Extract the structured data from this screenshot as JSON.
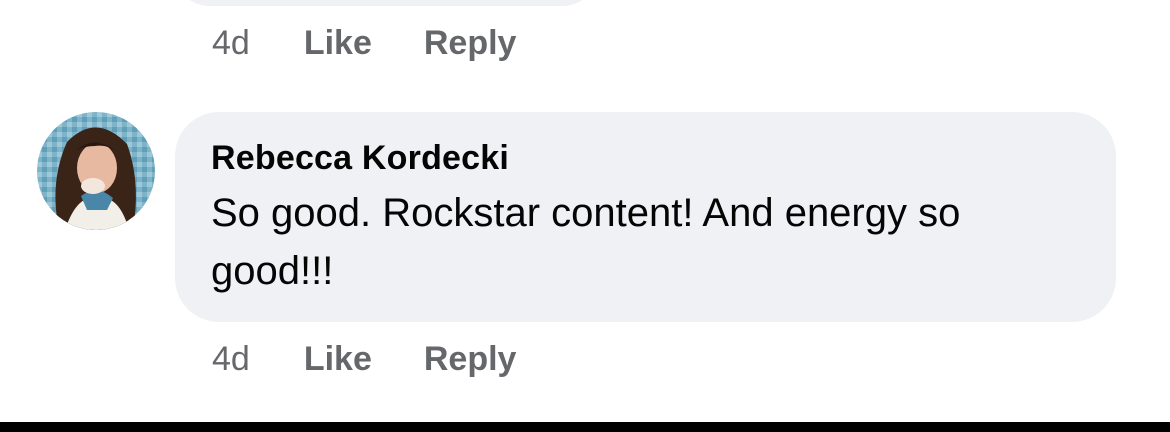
{
  "comments": [
    {
      "time": "4d",
      "like_label": "Like",
      "reply_label": "Reply"
    },
    {
      "author": "Rebecca Kordecki",
      "text": "So good. Rockstar content! And energy so good!!!",
      "time": "4d",
      "like_label": "Like",
      "reply_label": "Reply"
    }
  ]
}
